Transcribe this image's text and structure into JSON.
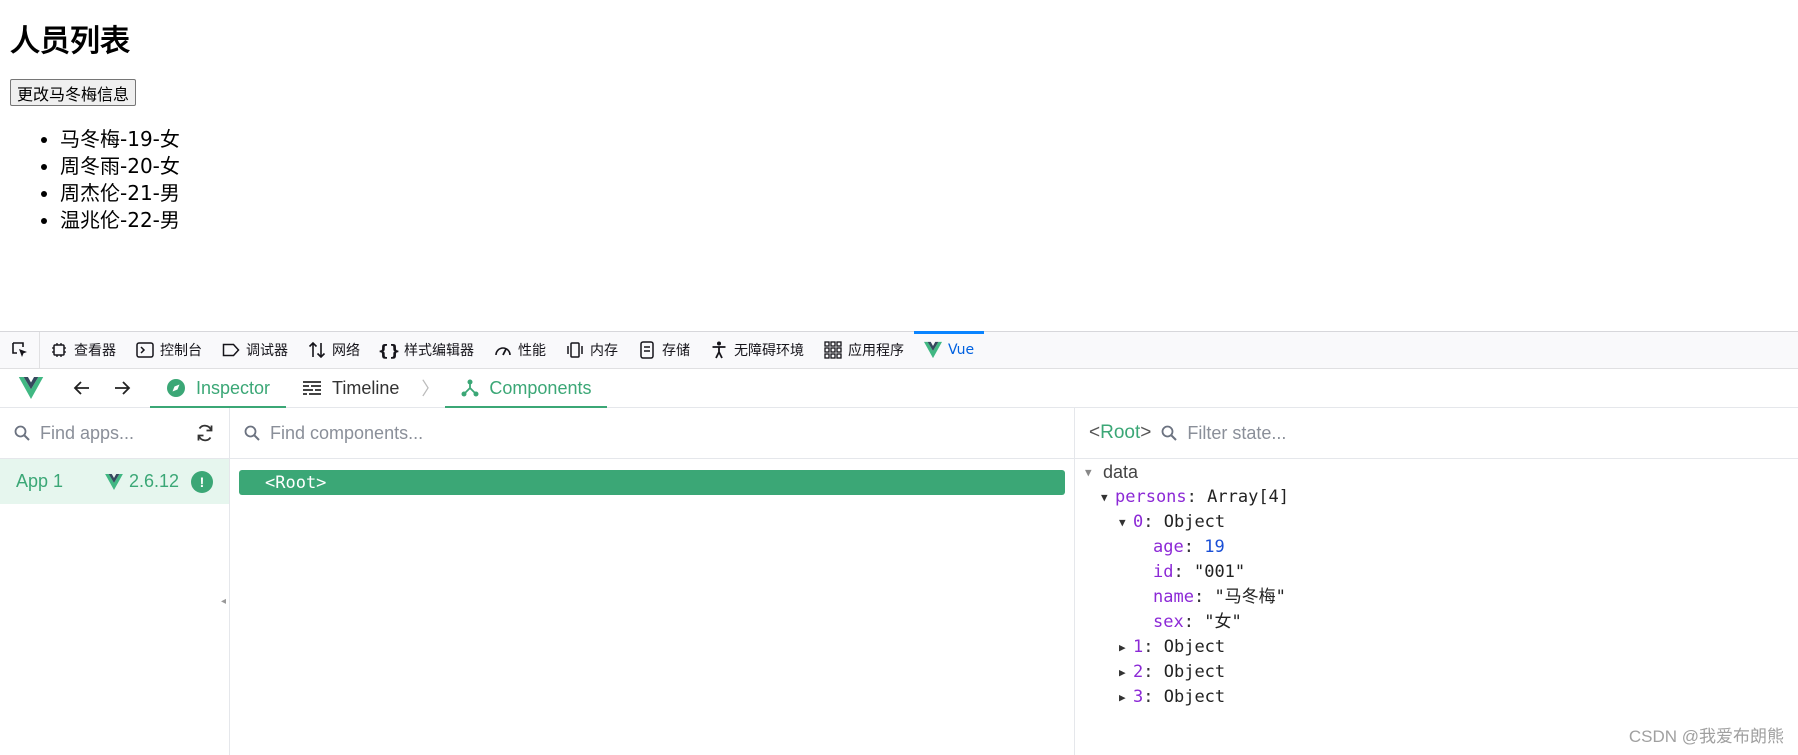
{
  "page": {
    "title": "人员列表",
    "button_label": "更改马冬梅信息",
    "persons": [
      "马冬梅-19-女",
      "周冬雨-20-女",
      "周杰伦-21-男",
      "温兆伦-22-男"
    ]
  },
  "devtools": {
    "tabs": [
      {
        "label": "查看器",
        "icon": "inspector-icon"
      },
      {
        "label": "控制台",
        "icon": "console-icon"
      },
      {
        "label": "调试器",
        "icon": "debugger-icon"
      },
      {
        "label": "网络",
        "icon": "network-icon"
      },
      {
        "label": "样式编辑器",
        "icon": "style-editor-icon"
      },
      {
        "label": "性能",
        "icon": "performance-icon"
      },
      {
        "label": "内存",
        "icon": "memory-icon"
      },
      {
        "label": "存储",
        "icon": "storage-icon"
      },
      {
        "label": "无障碍环境",
        "icon": "accessibility-icon"
      },
      {
        "label": "应用程序",
        "icon": "application-icon"
      },
      {
        "label": "Vue",
        "icon": "vue-logo-icon"
      }
    ],
    "active_tab": "Vue",
    "accent_color": "#0a84ff"
  },
  "vue": {
    "accent_color": "#3ba776",
    "tabs": {
      "inspector": "Inspector",
      "timeline": "Timeline",
      "components": "Components"
    },
    "apps": {
      "search_placeholder": "Find apps...",
      "app_name": "App 1",
      "version": "2.6.12",
      "warning": "!"
    },
    "components": {
      "search_placeholder": "Find components...",
      "root": "<Root>"
    },
    "state": {
      "root_open": "<",
      "root_name": "Root",
      "root_close": ">",
      "filter_placeholder": "Filter state...",
      "section": "data",
      "persons_key": "persons",
      "persons_type": "Array[4]",
      "item0_key": "0",
      "object_type": "Object",
      "fields": [
        {
          "key": "age",
          "value": "19",
          "kind": "num"
        },
        {
          "key": "id",
          "value": "\"001\"",
          "kind": "str"
        },
        {
          "key": "name",
          "value": "\"马冬梅\"",
          "kind": "str"
        },
        {
          "key": "sex",
          "value": "\"女\"",
          "kind": "str"
        }
      ],
      "collapsed_items": [
        "1",
        "2",
        "3"
      ]
    }
  },
  "watermark": "CSDN @我爱布朗熊"
}
